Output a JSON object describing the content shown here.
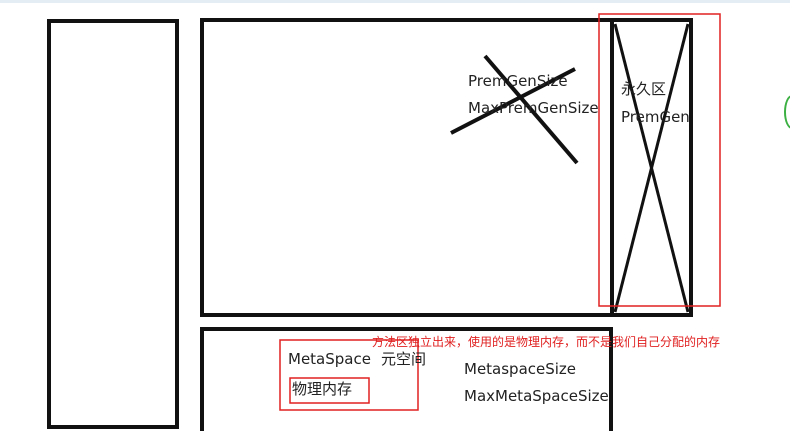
{
  "labels": {
    "permgen_size": "PremGenSize",
    "max_permgen_size": "MaxPremGenSize",
    "permgen_cn": "永久区",
    "permgen_en": "PremGen",
    "metaspace": "MetaSpace",
    "metaspace_cn": "元空间",
    "physical_memory": "物理内存",
    "metaspace_size": "MetaspaceSize",
    "max_metaspace_size": "MaxMetaSpaceSize"
  },
  "annotation": {
    "text": "方法区独立出来，使用的是物理内存，而不是我们自己分配的内存",
    "color": "#e02020"
  },
  "colors": {
    "stroke": "#111111",
    "highlight": "#e02020",
    "edge_glyph": "#3cb043"
  }
}
